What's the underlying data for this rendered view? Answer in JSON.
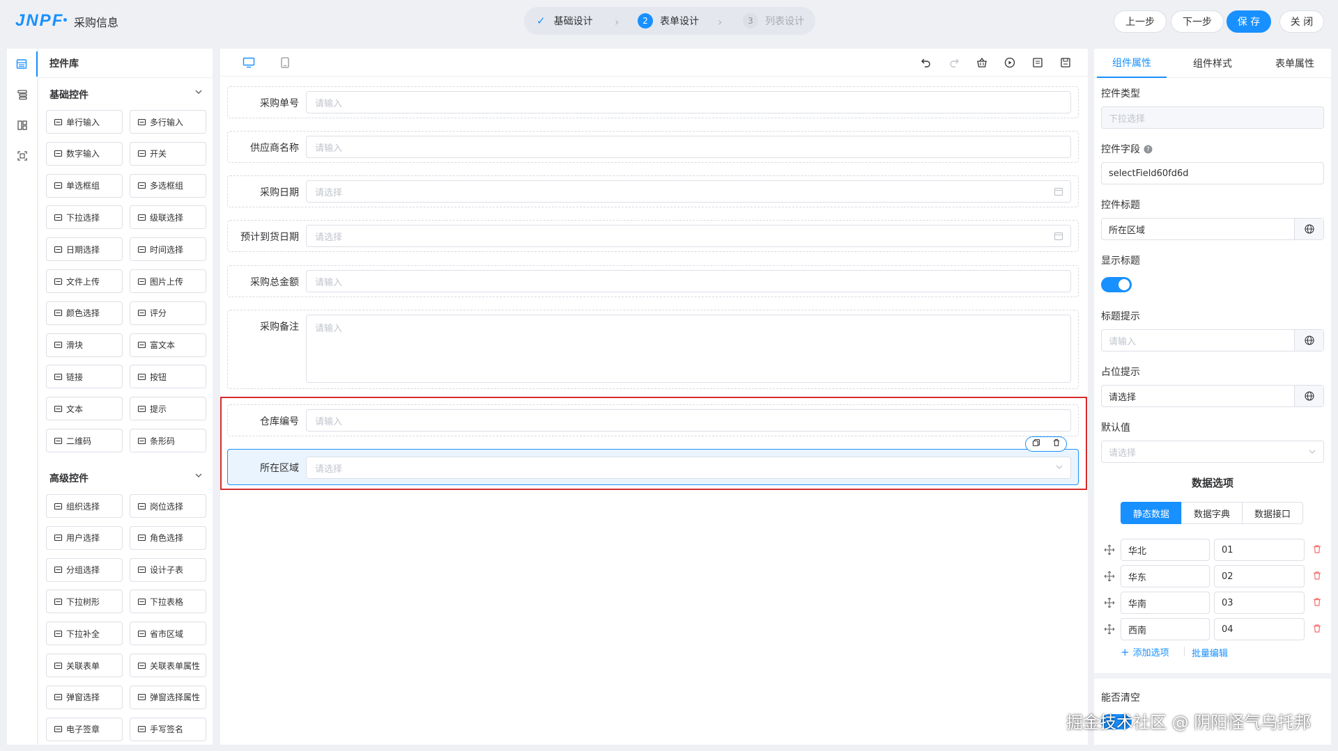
{
  "header": {
    "logo": "JNPF",
    "title": "采购信息",
    "steps": [
      {
        "label": "基础设计",
        "num": "✓"
      },
      {
        "label": "表单设计",
        "num": "2"
      },
      {
        "label": "列表设计",
        "num": "3"
      }
    ],
    "buttons": {
      "prev": "上一步",
      "next": "下一步",
      "save": "保 存",
      "close": "关 闭"
    }
  },
  "library": {
    "title": "控件库",
    "basic_title": "基础控件",
    "basic": [
      "单行输入",
      "多行输入",
      "数字输入",
      "开关",
      "单选框组",
      "多选框组",
      "下拉选择",
      "级联选择",
      "日期选择",
      "时间选择",
      "文件上传",
      "图片上传",
      "颜色选择",
      "评分",
      "滑块",
      "富文本",
      "链接",
      "按钮",
      "文本",
      "提示",
      "二维码",
      "条形码"
    ],
    "advanced_title": "高级控件",
    "advanced": [
      "组织选择",
      "岗位选择",
      "用户选择",
      "角色选择",
      "分组选择",
      "设计子表",
      "下拉树形",
      "下拉表格",
      "下拉补全",
      "省市区域",
      "关联表单",
      "关联表单属性",
      "弹窗选择",
      "弹窗选择属性",
      "电子签章",
      "手写签名"
    ]
  },
  "form": {
    "fields": [
      {
        "label": "采购单号",
        "placeholder": "请输入"
      },
      {
        "label": "供应商名称",
        "placeholder": "请输入"
      },
      {
        "label": "采购日期",
        "placeholder": "请选择"
      },
      {
        "label": "预计到货日期",
        "placeholder": "请选择"
      },
      {
        "label": "采购总金额",
        "placeholder": "请输入"
      },
      {
        "label": "采购备注",
        "placeholder": "请输入"
      },
      {
        "label": "仓库编号",
        "placeholder": "请输入"
      },
      {
        "label": "所在区域",
        "placeholder": "请选择"
      }
    ]
  },
  "props": {
    "tabs": [
      "组件属性",
      "组件样式",
      "表单属性"
    ],
    "type_label": "控件类型",
    "type_value": "下拉选择",
    "field_label": "控件字段",
    "field_value": "selectField60fd6d",
    "title_label": "控件标题",
    "title_value": "所在区域",
    "show_title_label": "显示标题",
    "tip_label": "标题提示",
    "tip_placeholder": "请输入",
    "placeholder_label": "占位提示",
    "placeholder_value": "请选择",
    "default_label": "默认值",
    "default_placeholder": "请选择",
    "options_title": "数据选项",
    "source_tabs": [
      "静态数据",
      "数据字典",
      "数据接口"
    ],
    "options": [
      {
        "label": "华北",
        "value": "01"
      },
      {
        "label": "华东",
        "value": "02"
      },
      {
        "label": "华南",
        "value": "03"
      },
      {
        "label": "西南",
        "value": "04"
      }
    ],
    "add_option": "添加选项",
    "batch_edit": "批量编辑",
    "clearable_label": "能否清空"
  },
  "watermark": "掘金技术社区 @ 阴阳怪气乌托邦",
  "colors": {
    "accent": "#1890ff",
    "highlight_box": "#d52b2b",
    "delete": "#f56c6c"
  }
}
